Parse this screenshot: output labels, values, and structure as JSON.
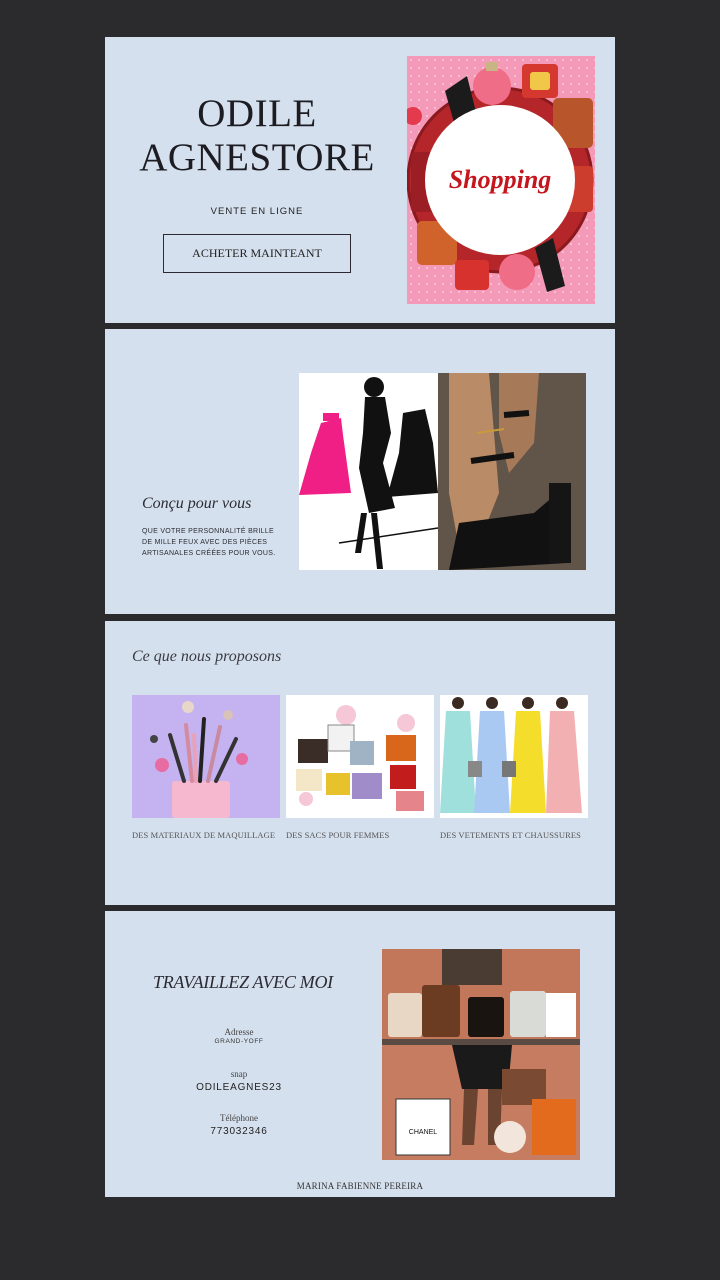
{
  "hero": {
    "brand_line1": "ODILE",
    "brand_line2": "AGNESTORE",
    "subtitle": "VENTE EN LIGNE",
    "cta_label": "ACHETER MAINTEANT",
    "image_text": "Shopping"
  },
  "about": {
    "title": "Conçu pour vous",
    "text": "QUE VOTRE PERSONNALITÉ BRILLE DE MILLE FEUX AVEC DES PIÈCES ARTISANALES CRÉÉES POUR VOUS."
  },
  "offer": {
    "title": "Ce que nous proposons",
    "items": [
      {
        "caption": "DES MATERIAUX DE MAQUILLAGE"
      },
      {
        "caption": "DES SACS POUR FEMMES"
      },
      {
        "caption": "DES VETEMENTS ET CHAUSSURES"
      }
    ]
  },
  "contact": {
    "title": "TRAVAILLEZ AVEC MOI",
    "address_label": "Adresse",
    "address_value": "GRAND-YOFF",
    "snap_label": "snap",
    "snap_value": "ODILEAGNES23",
    "phone_label": "Téléphone",
    "phone_value": "773032346",
    "bag_brand": "CHANEL",
    "footer": "MARINA FABIENNE PEREIRA"
  },
  "colors": {
    "page_bg": "#2b2b2d",
    "panel_bg": "#d5e0ee",
    "text_dark": "#1c1c22",
    "shopping_red": "#c4161c"
  }
}
